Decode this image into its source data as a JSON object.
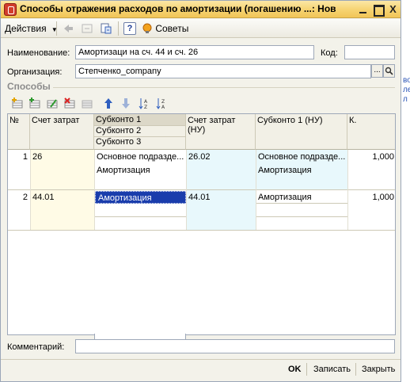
{
  "window": {
    "title": "Способы отражения расходов по амортизации (погашению ...: Новый *",
    "minimize_label": "_",
    "maximize_label": "□",
    "close_label": "X"
  },
  "toolbar": {
    "actions_label": "Действия",
    "help_label": "?",
    "tips_label": "Советы"
  },
  "form": {
    "name_label": "Наименование:",
    "name_value": "Амортизаци на сч. 44 и сч. 26",
    "code_label": "Код:",
    "code_value": "",
    "org_label": "Организация:",
    "org_value": "Степченко_company",
    "select_button": "...",
    "search_button": "🔍",
    "comment_label": "Комментарий:",
    "comment_value": ""
  },
  "section": {
    "title": "Способы"
  },
  "table": {
    "headers": {
      "num": "№",
      "account": "Счет затрат",
      "subconto1": "Субконто 1",
      "subconto2": "Субконто 2",
      "subconto3": "Субконто 3",
      "account_nu": "Счет затрат (НУ)",
      "subconto1_nu": "Субконто 1 (НУ)",
      "k": "К."
    },
    "rows": [
      {
        "num": "1",
        "account": "26",
        "subconto1": "Основное подразде...",
        "subconto2": "Амортизация",
        "account_nu": "26.02",
        "subconto1_nu": "Основное подразде...",
        "subconto2_nu": "Амортизация",
        "k": "1,000"
      },
      {
        "num": "2",
        "account": "44.01",
        "subconto1": "Амортизация",
        "subconto2": "",
        "account_nu": "44.01",
        "subconto1_nu": "Амортизация",
        "subconto2_nu": "",
        "k": "1,000"
      }
    ]
  },
  "footer": {
    "ok_label": "OK",
    "save_label": "Записать",
    "close_label": "Закрыть"
  },
  "background": {
    "link1": "во",
    "link2": "ле",
    "link3": "л"
  },
  "icons": [
    "app-icon",
    "back-icon",
    "forward-icon",
    "refresh-icon",
    "help-icon",
    "tips-icon",
    "add-row-icon",
    "copy-row-icon",
    "edit-row-icon",
    "delete-row-icon",
    "end-edit-icon",
    "move-up-icon",
    "move-down-icon",
    "sort-asc-icon",
    "sort-desc-icon",
    "dropdown-arrow-icon"
  ],
  "colors": {
    "title_bar": "#f6d371",
    "selection": "#1a3dac",
    "account_tint": "#fffbe6",
    "nu_tint": "#e8f8fc"
  }
}
